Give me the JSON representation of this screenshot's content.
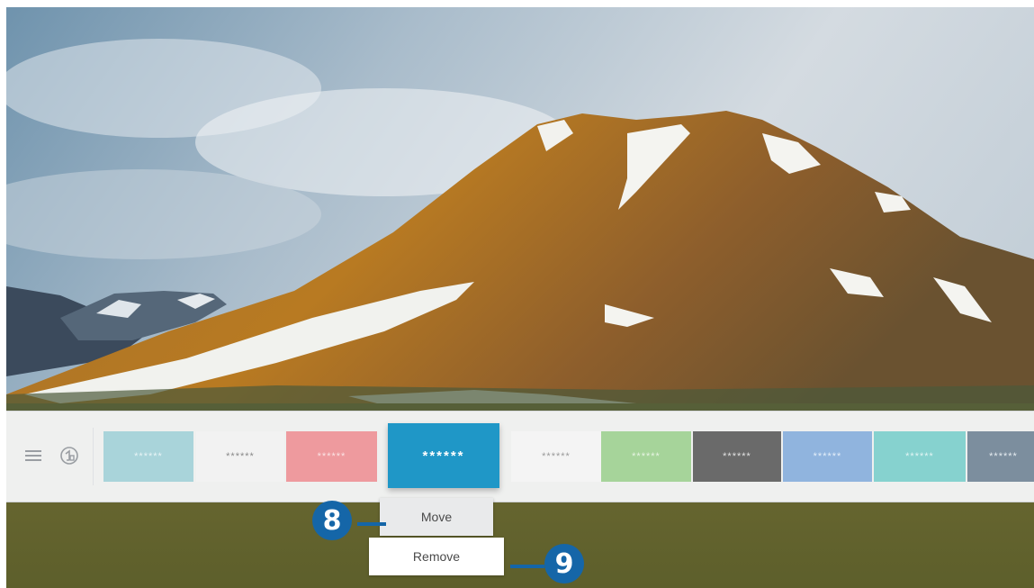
{
  "smart_hub": {
    "menu_icon": "hamburger-menu-icon",
    "source_icon": "source-input-icon",
    "tiles": [
      {
        "label": "******",
        "bg": "#a9d4da",
        "fg": "#e8f4f6"
      },
      {
        "label": "******",
        "bg": "#f2f2f2",
        "fg": "#8a8a8a"
      },
      {
        "label": "******",
        "bg": "#ee9a9e",
        "fg": "#fbe3e4"
      },
      {
        "label": "******",
        "bg": "#1f97c7",
        "fg": "#ffffff",
        "focused": true
      },
      {
        "label": "******",
        "bg": "#f4f4f4",
        "fg": "#9a9a9a"
      },
      {
        "label": "******",
        "bg": "#a6d49a",
        "fg": "#e7f4e2"
      },
      {
        "label": "******",
        "bg": "#6a6a6a",
        "fg": "#e2e2e2"
      },
      {
        "label": "******",
        "bg": "#90b4de",
        "fg": "#e4eef9"
      },
      {
        "label": "******",
        "bg": "#86d2cf",
        "fg": "#e2f5f4"
      },
      {
        "label": "******",
        "bg": "#7c8e9e",
        "fg": "#e6ecf1"
      }
    ]
  },
  "context_menu": {
    "move_label": "Move",
    "remove_label": "Remove"
  },
  "callouts": {
    "move_number": "8",
    "remove_number": "9",
    "color": "#1566a8"
  }
}
